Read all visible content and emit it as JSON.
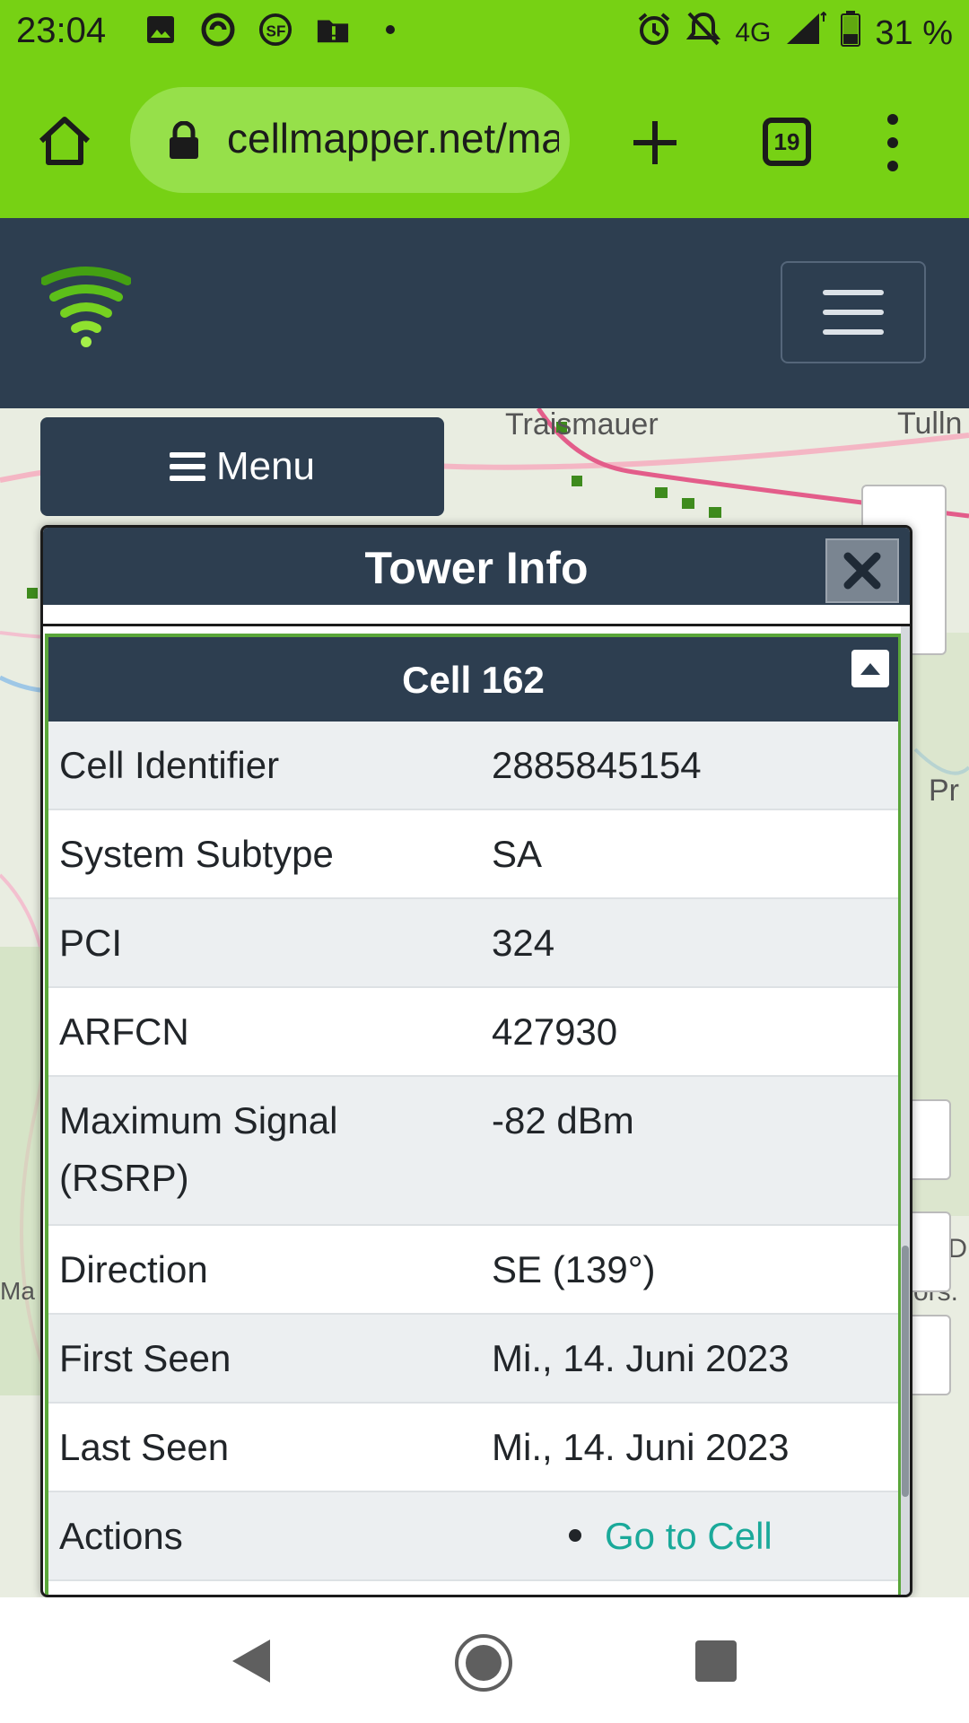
{
  "status_bar": {
    "time": "23:04",
    "network": "4G",
    "battery": "31 %",
    "left_icons": [
      "gallery-icon",
      "sync-icon",
      "sf-icon",
      "alert-folder-icon",
      "dot-icon"
    ],
    "right_icons": [
      "alarm-icon",
      "notifications-off-icon",
      "signal-icon",
      "battery-icon"
    ]
  },
  "browser": {
    "url": "cellmapper.net/map",
    "tab_count": "19"
  },
  "map": {
    "labels": {
      "traismauer": "Traismauer",
      "tulln": "Tulln",
      "pre": "Pr",
      "attribution_1": "TED",
      "attribution_2": "ors.",
      "corner": "Ma"
    }
  },
  "menu_button": {
    "label": "Menu"
  },
  "panel": {
    "title": "Tower Info",
    "cell": {
      "title": "Cell 162",
      "rows": [
        {
          "label": "Cell Identifier",
          "value": "2885845154"
        },
        {
          "label": "System Subtype",
          "value": "SA"
        },
        {
          "label": "PCI",
          "value": "324"
        },
        {
          "label": "ARFCN",
          "value": "427930"
        },
        {
          "label": "Maximum Signal (RSRP)",
          "value": "-82 dBm"
        },
        {
          "label": "Direction",
          "value": "SE (139°)"
        },
        {
          "label": "First Seen",
          "value": "Mi., 14. Juni 2023"
        },
        {
          "label": "Last Seen",
          "value": "Mi., 14. Juni 2023"
        },
        {
          "label": "Actions",
          "value": "Go to Cell"
        }
      ]
    }
  },
  "colors": {
    "status_green": "#77d114",
    "header_navy": "#2d3e50",
    "link_teal": "#1aa99a",
    "card_border_green": "#5aa63a"
  }
}
